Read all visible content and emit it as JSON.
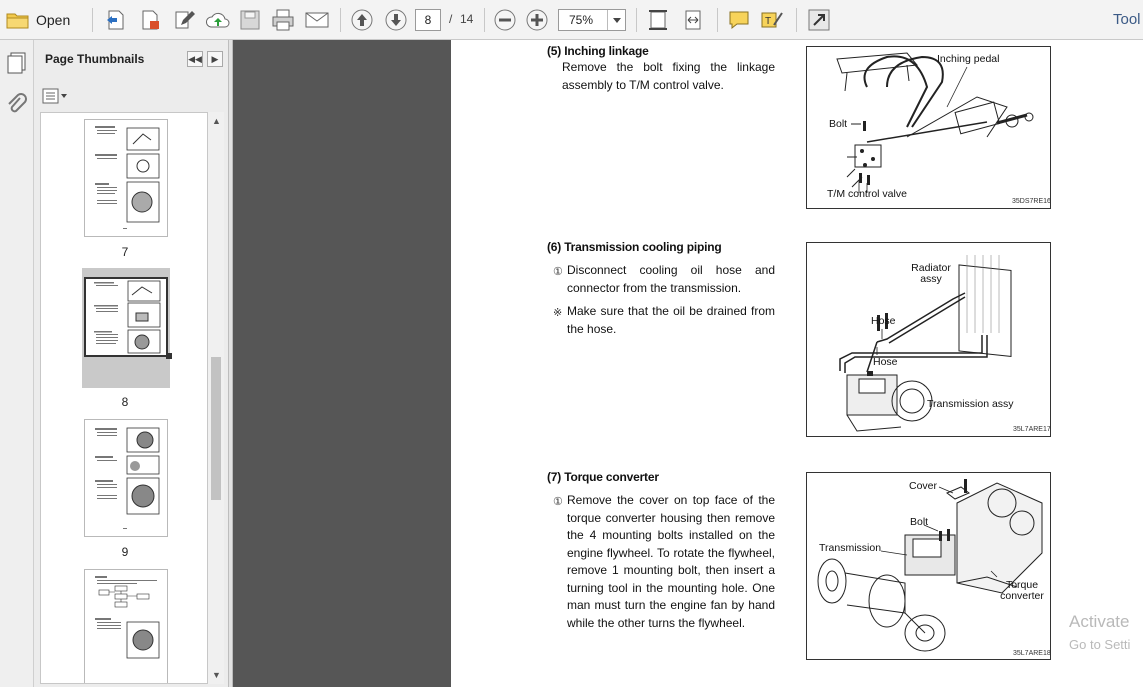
{
  "toolbar": {
    "open_label": "Open",
    "page_current": "8",
    "page_separator": "/",
    "page_total": "14",
    "zoom": "75%",
    "tools_label": "Tool"
  },
  "panel": {
    "title": "Page Thumbnails",
    "thumbnails": [
      {
        "label": "7"
      },
      {
        "label": "8"
      },
      {
        "label": "9"
      },
      {
        "label": ""
      }
    ]
  },
  "document": {
    "sections": [
      {
        "title": "(5) Inching linkage",
        "items": [
          {
            "marker": "",
            "text": "Remove the bolt fixing the linkage assembly to T/M control valve."
          }
        ],
        "figure": {
          "labels": [
            "Inching pedal",
            "Bolt",
            "T/M control valve"
          ],
          "code": "35DS7RE16"
        }
      },
      {
        "title": "(6) Transmission cooling piping",
        "items": [
          {
            "marker": "①",
            "text": "Disconnect cooling oil hose and connector from the transmission."
          },
          {
            "marker": "※",
            "text": "Make sure that the oil be drained from the hose."
          }
        ],
        "figure": {
          "labels": [
            "Radiator assy",
            "Hose",
            "Hose",
            "Transmission assy"
          ],
          "code": "35L7ARE17"
        }
      },
      {
        "title": "(7) Torque converter",
        "items": [
          {
            "marker": "①",
            "text": "Remove the cover on top face of the torque converter housing then remove the 4 mounting bolts installed on the engine flywheel.  To rotate the flywheel, remove 1 mounting bolt, then insert a turning tool in the mounting hole.  One man must turn the engine fan by hand while the other turns the flywheel."
          }
        ],
        "figure": {
          "labels": [
            "Cover",
            "Bolt",
            "Transmission",
            "Torque converter"
          ],
          "code": "35L7ARE18"
        }
      }
    ]
  },
  "watermark": {
    "line1": "Activate",
    "line2": "Go to Setti"
  }
}
